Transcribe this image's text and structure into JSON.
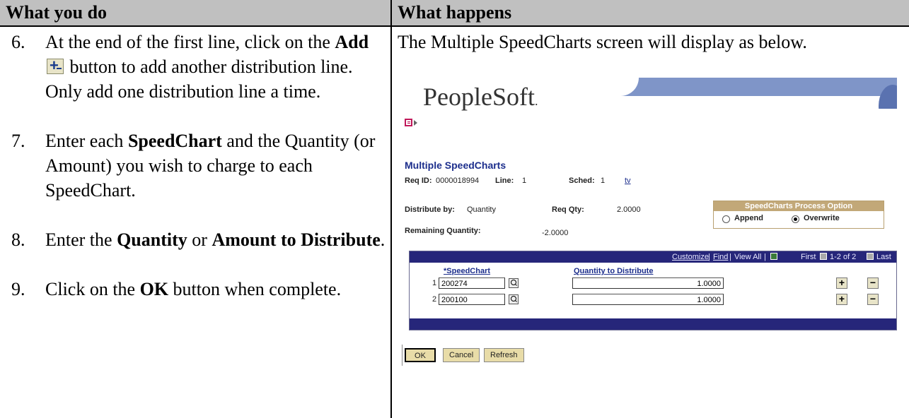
{
  "header": {
    "left": "What you do",
    "right": "What happens"
  },
  "steps": [
    {
      "num": "6.",
      "pre": "At the end of the first line, click on the ",
      "bold": "Add",
      "post": " button to add another distribution line.  Only add one distribution line a time."
    },
    {
      "num": "7.",
      "pre": "Enter each ",
      "bold": "SpeedChart",
      "post": " and the Quantity (or Amount) you wish to charge to each SpeedChart."
    },
    {
      "num": "8.",
      "pre": "Enter the ",
      "bold": "Quantity",
      "mid": " or ",
      "bold2": "Amount to Distribute",
      "post": "."
    },
    {
      "num": "9.",
      "pre": "Click on the ",
      "bold": "OK",
      "post": " button when complete."
    }
  ],
  "intro": "The Multiple SpeedCharts screen will display as below.",
  "ps": {
    "logo": "PeopleSoft",
    "logo_dot": ".",
    "title": "Multiple SpeedCharts",
    "req_id_label": "Req ID:",
    "req_id": "0000018994",
    "line_label": "Line:",
    "line": "1",
    "sched_label": "Sched:",
    "sched": "1",
    "tv_link": "tv",
    "distribute_by_label": "Distribute by:",
    "distribute_by": "Quantity",
    "req_qty_label": "Req Qty:",
    "req_qty": "2.0000",
    "remaining_label": "Remaining Quantity:",
    "remaining": "-2.0000",
    "option_title": "SpeedCharts Process Option",
    "option_append": "Append",
    "option_overwrite": "Overwrite",
    "grid_customize": "Customize",
    "grid_find": "Find",
    "grid_viewall": "View All",
    "grid_first": "First",
    "grid_range": "1-2 of 2",
    "grid_last": "Last",
    "sep": "|",
    "col_speedchart": "*SpeedChart",
    "col_qty": "Quantity to Distribute",
    "rows": [
      {
        "num": "1",
        "speedchart": "200274",
        "qty": "1.0000"
      },
      {
        "num": "2",
        "speedchart": "200100",
        "qty": "1.0000"
      }
    ],
    "btn_ok": "OK",
    "btn_cancel": "Cancel",
    "btn_refresh": "Refresh",
    "plus": "+",
    "minus": "−"
  }
}
